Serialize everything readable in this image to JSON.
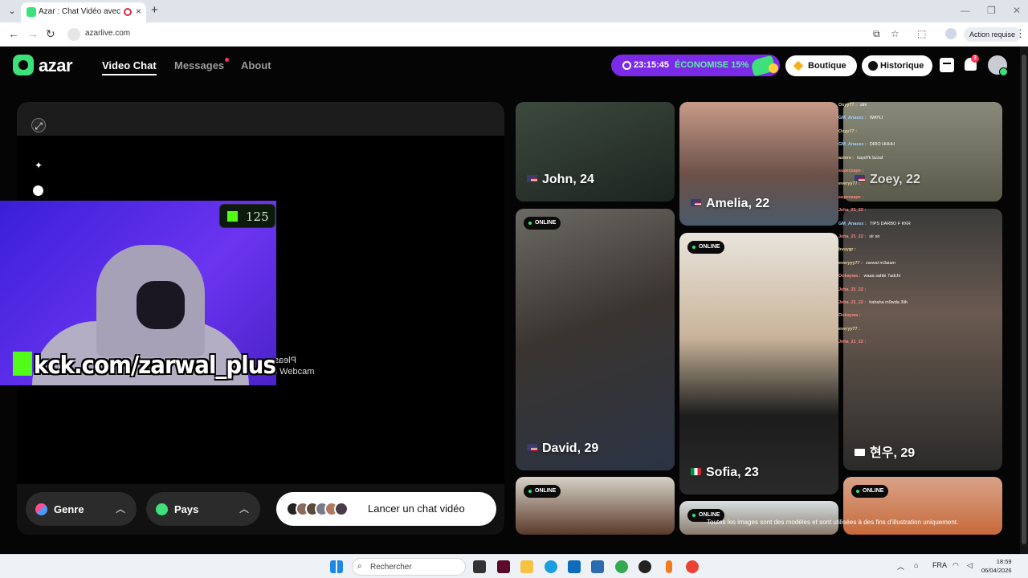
{
  "browser": {
    "tab_title": "Azar : Chat Vidéo avec de n",
    "url": "azarlive.com",
    "action_label": "Action requise"
  },
  "header": {
    "logo": "azar",
    "nav": [
      "Video Chat",
      "Messages",
      "About"
    ],
    "promo_timer": "23:15:45",
    "promo_label": "ÉCONOMISE 15%",
    "boutique_label": "Boutique",
    "historique_label": "Historique",
    "notif_count": "3"
  },
  "video": {
    "webcam_msg_1": "Please sta",
    "webcam_msg_2": "n Webcam",
    "filters": {
      "genre": "Genre",
      "pays": "Pays"
    },
    "launch_label": "Lancer un chat vidéo"
  },
  "stream_overlay": {
    "viewer_count": "125",
    "link": "kck.com/zarwal_plus"
  },
  "profiles": [
    {
      "name": "John, 24",
      "flag": "us",
      "online": false
    },
    {
      "name": "Amelia, 22",
      "flag": "us",
      "online": false
    },
    {
      "name": "Zoey, 22",
      "flag": "us",
      "online": false
    },
    {
      "name": "David, 29",
      "flag": "us",
      "online": true
    },
    {
      "name": "Sofia, 23",
      "flag": "it",
      "online": true
    },
    {
      "name": "현우, 29",
      "flag": "kr",
      "online": false
    },
    {
      "name": "",
      "flag": "",
      "online": true
    },
    {
      "name": "",
      "flag": "",
      "online": true
    },
    {
      "name": "",
      "flag": "",
      "online": true
    }
  ],
  "online_label": "ONLINE",
  "disclaimer": "Toutes les images sont des modèles et sont utilisées à des fins d'illustration uniquement.",
  "chat": [
    {
      "user": "Oxyy77 :",
      "msg": "slm"
    },
    {
      "user": "GM_Anassx :",
      "msg": "WAYLI"
    },
    {
      "user": "Oxyy77 :",
      "msg": ""
    },
    {
      "user": "GM_Anassx :",
      "msg": "DIRO HHHH"
    },
    {
      "user": "aslere :",
      "msg": "kayd7k bzzaf"
    },
    {
      "user": "superpape :",
      "msg": ""
    },
    {
      "user": "everyy77 :",
      "msg": ""
    },
    {
      "user": "superpape :",
      "msg": ""
    },
    {
      "user": "Jeha_21_22 :",
      "msg": ""
    },
    {
      "user": "GM_Anassx :",
      "msg": "TIPS DARBO F KKR"
    },
    {
      "user": "Jeha_21_22 :",
      "msg": "sir sir"
    },
    {
      "user": "bvuygr :",
      "msg": ""
    },
    {
      "user": "everyyy77 :",
      "msg": "zarwal m3aiam"
    },
    {
      "user": "Ookaywa :",
      "msg": "waaa sahbi 7adchi"
    },
    {
      "user": "Jeha_21_22 :",
      "msg": ""
    },
    {
      "user": "Jeha_21_22 :",
      "msg": "hahaha m9wda 3lih"
    },
    {
      "user": "Ookaywa :",
      "msg": ""
    },
    {
      "user": "everyy77 :",
      "msg": ""
    },
    {
      "user": "Jeha_21_22 :",
      "msg": ""
    }
  ],
  "taskbar": {
    "search_placeholder": "Rechercher",
    "lang": "FRA",
    "time": "18:59",
    "date": "06/04/2026"
  },
  "colors": {
    "accent_green": "#3ee07a",
    "promo_purple": "#7b2be8",
    "kick_green": "#53fc18"
  }
}
